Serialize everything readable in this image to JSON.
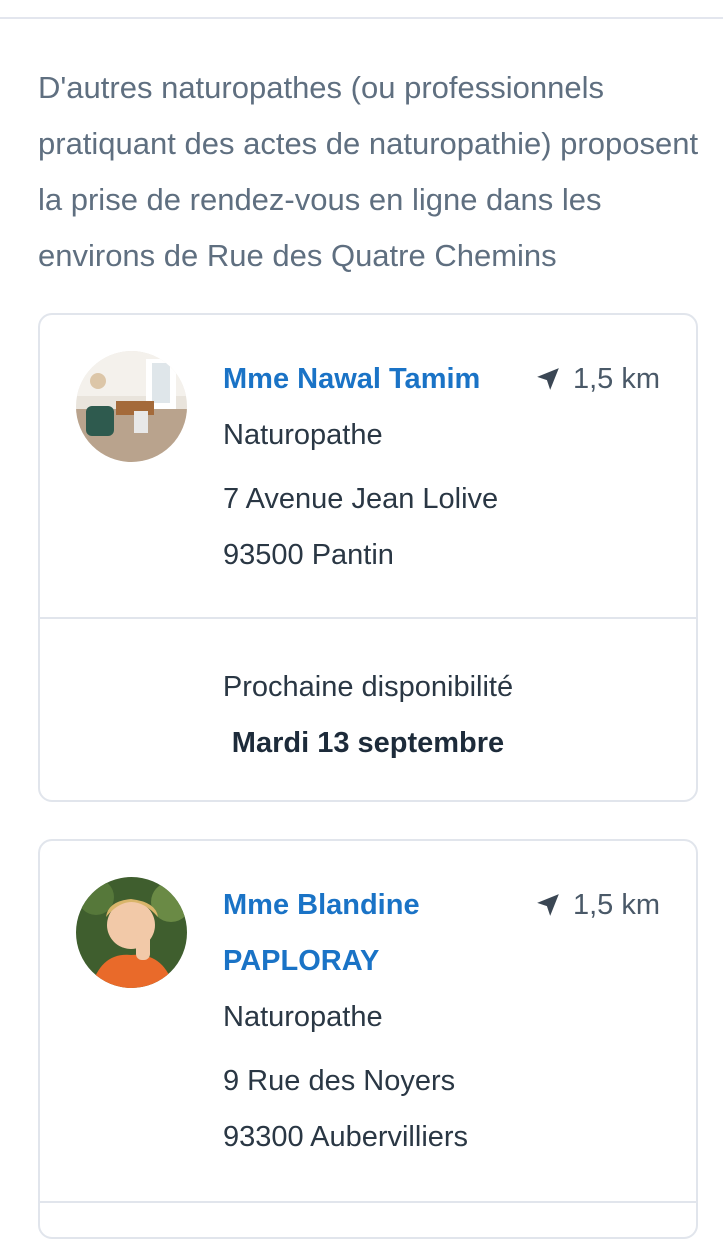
{
  "intro_text": "D'autres naturopathes (ou professionnels pratiquant des actes de naturopathie) proposent la prise de rendez-vous en ligne dans les environs de Rue des Quatre Chemins",
  "practitioners": [
    {
      "name": "Mme Nawal Tamim",
      "distance": "1,5 km",
      "specialty": "Naturopathe",
      "street": "7 Avenue Jean Lolive",
      "city": "93500 Pantin",
      "availability_label": "Prochaine disponibilité",
      "availability_date": "Mardi 13 septembre",
      "avatar_icon": "office-room-photo"
    },
    {
      "name": "Mme Blandine PAPLORAY",
      "distance": "1,5 km",
      "specialty": "Naturopathe",
      "street": "9 Rue des Noyers",
      "city": "93300 Aubervilliers",
      "avatar_icon": "portrait-photo"
    }
  ],
  "icons": {
    "distance": "location-arrow-icon"
  },
  "colors": {
    "name_link": "#1a73c6",
    "intro_text": "#5f6f80",
    "card_border": "#e1e5ec"
  }
}
